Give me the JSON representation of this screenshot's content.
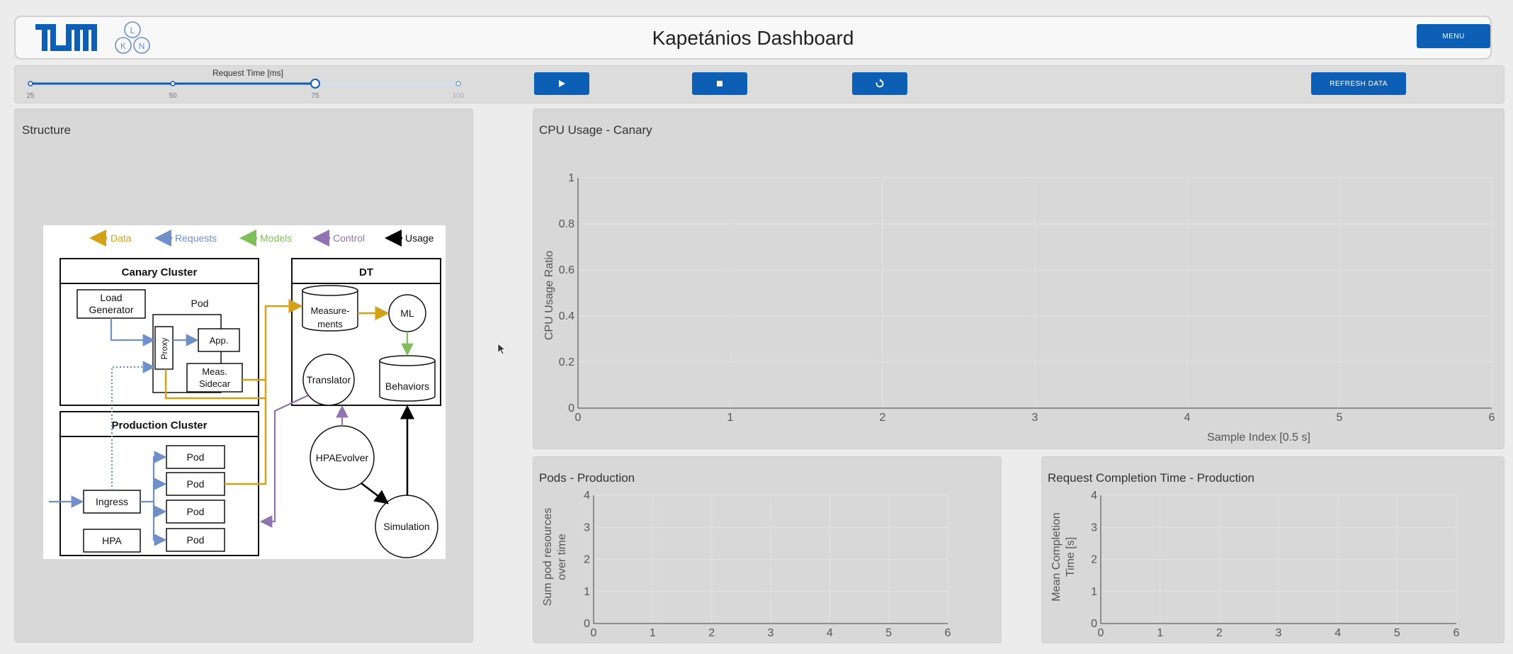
{
  "header": {
    "title": "Kapetánios Dashboard",
    "logo_text": "TUM",
    "lkn_letters": [
      "L",
      "K",
      "N"
    ],
    "menu_label": "MENU"
  },
  "controls": {
    "slider": {
      "label": "Request Time [ms]",
      "ticks": [
        "25",
        "50",
        "75",
        "100"
      ],
      "value": 75
    },
    "play_icon": "play-icon",
    "stop_icon": "stop-icon",
    "reset_icon": "reset-icon",
    "refresh_label": "REFRESH DATA"
  },
  "structure": {
    "title": "Structure",
    "diagram": {
      "legend": [
        {
          "label": "Data",
          "color": "#d4a017"
        },
        {
          "label": "Requests",
          "color": "#6f8fc9"
        },
        {
          "label": "Models",
          "color": "#7fbf5a"
        },
        {
          "label": "Control",
          "color": "#8f73b2"
        },
        {
          "label": "Usage",
          "color": "#000000"
        }
      ],
      "canary_cluster": "Canary Cluster",
      "load_generator": [
        "Load",
        "Generator"
      ],
      "pod": "Pod",
      "proxy": "Proxy",
      "app": "App.",
      "meas_sidecar": [
        "Meas.",
        "Sidecar"
      ],
      "production_cluster": "Production Cluster",
      "ingress": "Ingress",
      "hpa": "HPA",
      "pods": [
        "Pod",
        "Pod",
        "Pod",
        "Pod"
      ],
      "dt": "DT",
      "measurements": [
        "Measure-",
        "ments"
      ],
      "ml": "ML",
      "translator": "Translator",
      "behaviors": "Behaviors",
      "hpaevolver": "HPAEvolver",
      "simulation": "Simulation"
    }
  },
  "charts": {
    "cpu": {
      "title": "CPU Usage - Canary",
      "ylabel": "CPU Usage Ratio",
      "xlabel": "Sample Index [0.5 s]"
    },
    "pods": {
      "title": "Pods - Production",
      "ylabel_lines": [
        "Sum pod resources",
        "over time"
      ]
    },
    "rct": {
      "title": "Request Completion Time - Production",
      "ylabel_lines": [
        "Mean Completion",
        "Time [s]"
      ]
    }
  },
  "chart_data": [
    {
      "type": "line",
      "title": "CPU Usage - Canary",
      "xlabel": "Sample Index [0.5 s]",
      "ylabel": "CPU Usage Ratio",
      "xlim": [
        0,
        6
      ],
      "ylim": [
        0,
        1
      ],
      "x_ticks": [
        "0",
        "1",
        "2",
        "3",
        "4",
        "5",
        "6"
      ],
      "y_ticks": [
        "0",
        "0.2",
        "0.4",
        "0.6",
        "0.8",
        "1"
      ],
      "series": [],
      "grid": true
    },
    {
      "type": "line",
      "title": "Pods - Production",
      "ylabel": "Sum pod resources over time",
      "xlim": [
        0,
        6
      ],
      "ylim": [
        0,
        4
      ],
      "x_ticks": [
        "0",
        "1",
        "2",
        "3",
        "4",
        "5",
        "6"
      ],
      "y_ticks": [
        "0",
        "1",
        "2",
        "3",
        "4"
      ],
      "series": [],
      "grid": true
    },
    {
      "type": "line",
      "title": "Request Completion Time - Production",
      "ylabel": "Mean Completion Time [s]",
      "xlim": [
        0,
        6
      ],
      "ylim": [
        0,
        4
      ],
      "x_ticks": [
        "0",
        "1",
        "2",
        "3",
        "4",
        "5",
        "6"
      ],
      "y_ticks": [
        "0",
        "1",
        "2",
        "3",
        "4"
      ],
      "series": [],
      "grid": true
    }
  ]
}
